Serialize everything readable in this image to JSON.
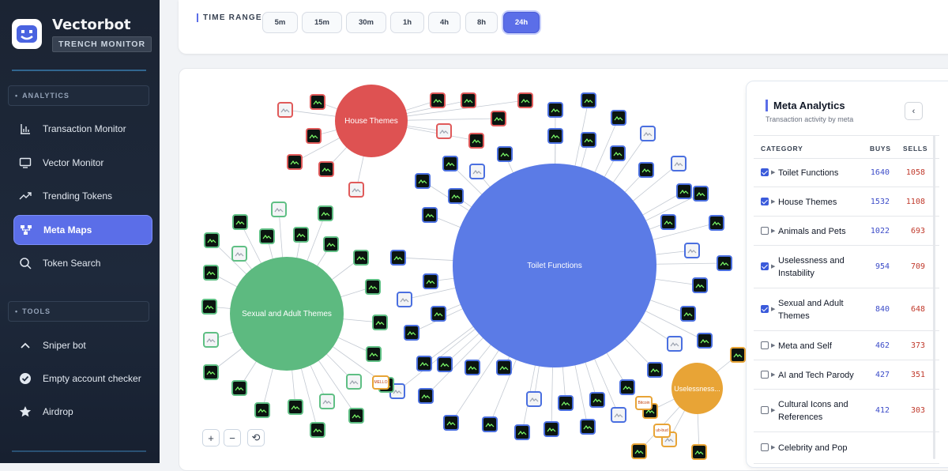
{
  "app": {
    "name": "Vectorbot",
    "subtitle": "TRENCH MONITOR"
  },
  "sidebar": {
    "analytics_label": "ANALYTICS",
    "tools_label": "TOOLS",
    "analytics_items": [
      {
        "label": "Transaction Monitor",
        "icon": "bar-chart-icon"
      },
      {
        "label": "Vector Monitor",
        "icon": "monitor-icon"
      },
      {
        "label": "Trending Tokens",
        "icon": "trend-up-icon"
      },
      {
        "label": "Meta Maps",
        "icon": "map-icon",
        "active": true
      },
      {
        "label": "Token Search",
        "icon": "search-icon"
      }
    ],
    "tool_items": [
      {
        "label": "Sniper bot",
        "icon": "chevron-up-icon"
      },
      {
        "label": "Empty account checker",
        "icon": "check-circle-icon"
      },
      {
        "label": "Airdrop",
        "icon": "star-icon"
      }
    ]
  },
  "time_range": {
    "label": "TIME RANGE",
    "options": [
      "5m",
      "15m",
      "30m",
      "1h",
      "4h",
      "8h",
      "24h"
    ],
    "selected": "24h"
  },
  "map": {
    "bubbles": [
      {
        "label": "Toilet Functions",
        "color": "#5b7be6"
      },
      {
        "label": "House Themes",
        "color": "#de5252"
      },
      {
        "label": "Sexual and Adult Themes",
        "color": "#5dba80"
      },
      {
        "label": "Uselessness...",
        "color": "#e8a436"
      }
    ],
    "node_texts": {
      "ubud": "ub-bud",
      "bitcoin": "Bitcoin",
      "mcu": "MELLO"
    },
    "zoom": {
      "in": "+",
      "out": "−",
      "reset": "⟲"
    }
  },
  "panel": {
    "title": "Meta Analytics",
    "subtitle": "Transaction activity by meta",
    "collapse": "‹",
    "columns": {
      "category": "CATEGORY",
      "buys": "BUYS",
      "sells": "SELLS"
    },
    "rows": [
      {
        "name": "Toilet Functions",
        "buys": "1640",
        "sells": "1058",
        "checked": true
      },
      {
        "name": "House Themes",
        "buys": "1532",
        "sells": "1108",
        "checked": true
      },
      {
        "name": "Animals and Pets",
        "buys": "1022",
        "sells": "693",
        "checked": false
      },
      {
        "name": "Uselessness and Instability",
        "buys": "954",
        "sells": "709",
        "checked": true
      },
      {
        "name": "Sexual and Adult Themes",
        "buys": "840",
        "sells": "648",
        "checked": true
      },
      {
        "name": "Meta and Self",
        "buys": "462",
        "sells": "373",
        "checked": false
      },
      {
        "name": "AI and Tech Parody",
        "buys": "427",
        "sells": "351",
        "checked": false
      },
      {
        "name": "Cultural Icons and References",
        "buys": "412",
        "sells": "303",
        "checked": false
      },
      {
        "name": "Celebrity and Pop",
        "buys": "",
        "sells": "",
        "checked": false
      }
    ]
  }
}
